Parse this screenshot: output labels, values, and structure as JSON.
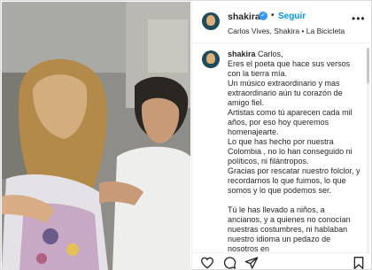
{
  "post": {
    "username": "shakira",
    "dot": "•",
    "follow_label": "Seguir",
    "subtitle": "Carlos Vives, Shakira • La Bicicleta",
    "more_icon": "more-horizontal-icon",
    "verified_icon": "verified-badge-icon"
  },
  "caption": {
    "username": "shakira",
    "lines": [
      "Carlos,",
      "Eres el poeta que hace sus versos con la tierra mía.",
      "Un músico extraordinario y mas extraordinario aún tu corazón de amigo fiel.",
      "Artistas como tú aparecen cada mil años, por eso hoy queremos homenajearte.",
      "Lo que has hecho por nuestra Colombia , no lo han conseguido ni políticos, ni filántropos.",
      "Gracias por rescatar nuestro folclor, y recordarnos lo que fuimos, lo que somos y lo que podemos ser.",
      "",
      "Tú le has llevado a niños, a ancianos, y a quienes no conocían nuestras costumbres, ni hablaban nuestro idioma un pedazo de nosotros en"
    ]
  },
  "actions": {
    "like_icon": "heart-icon",
    "comment_icon": "comment-icon",
    "share_icon": "share-icon",
    "save_icon": "bookmark-icon"
  },
  "colors": {
    "accent": "#0095f6",
    "verified": "#3897f0",
    "text": "#262626"
  }
}
